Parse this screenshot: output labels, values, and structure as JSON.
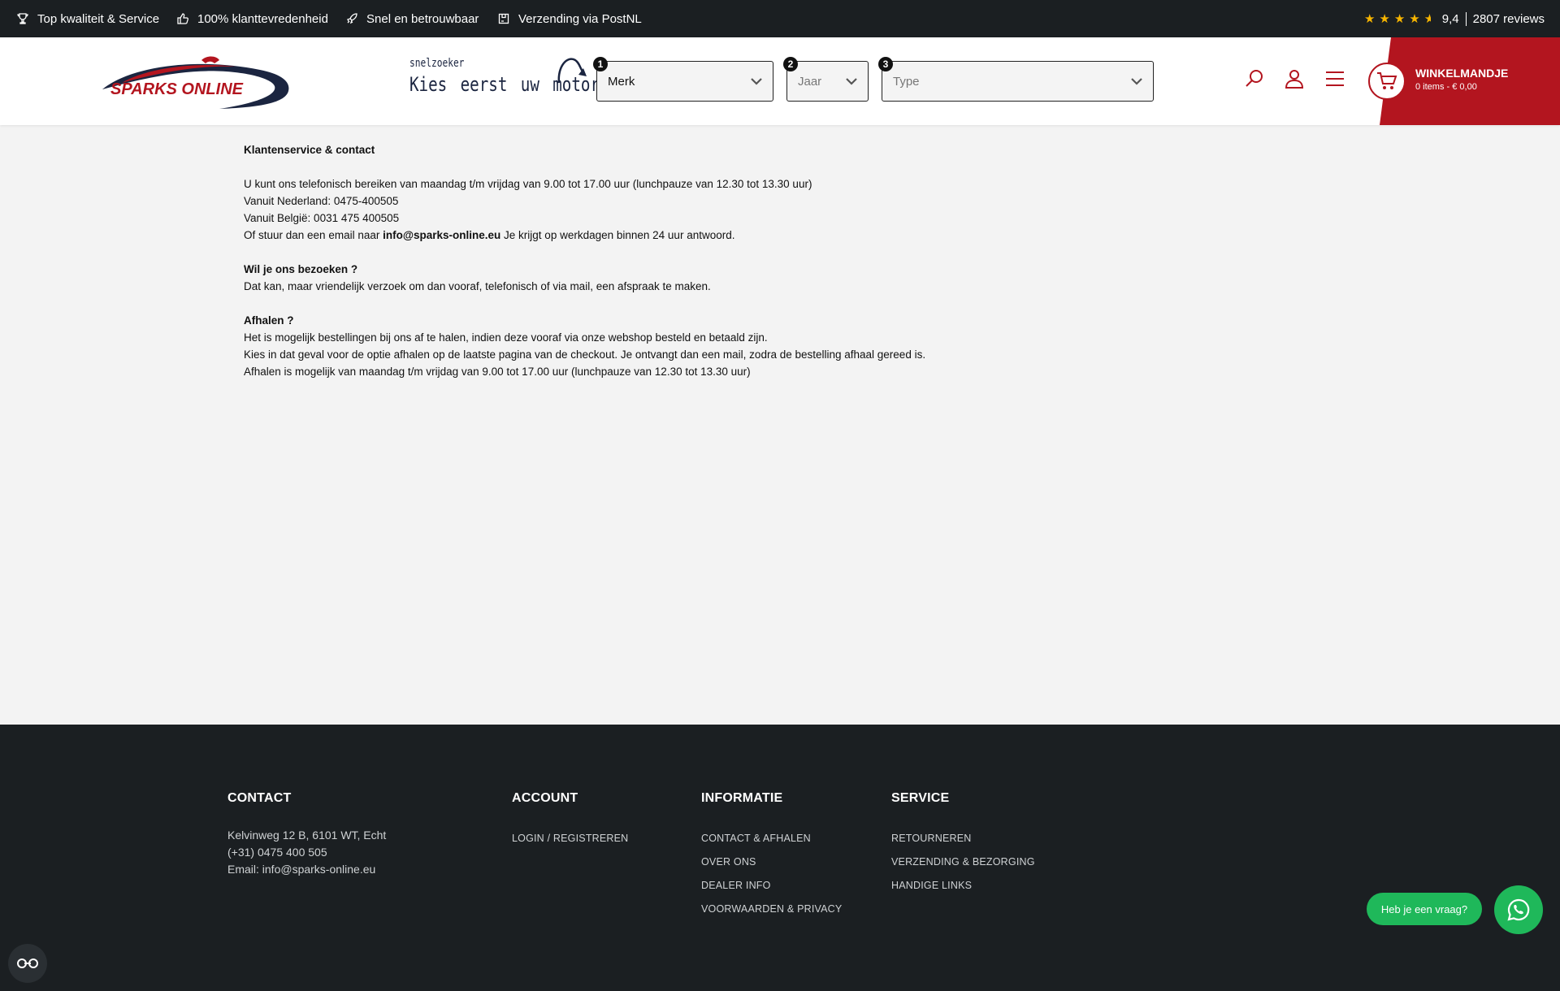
{
  "topbar": {
    "usps": [
      "Top kwaliteit & Service",
      "100% klanttevredenheid",
      "Snel en betrouwbaar",
      "Verzending via PostNL"
    ],
    "rating": {
      "stars": 4.5,
      "score": "9,4",
      "reviews": "2807 reviews"
    }
  },
  "header": {
    "logo_text": "SPARKS ONLINE",
    "quick_small": "snelzoeker",
    "quick_big": "Kies eerst uw motor",
    "selects": [
      {
        "num": "1",
        "value": "Merk"
      },
      {
        "num": "2",
        "value": "Jaar"
      },
      {
        "num": "3",
        "value": "Type"
      }
    ],
    "icons": [
      "search-icon",
      "user-icon",
      "menu-icon"
    ],
    "cart": {
      "title": "WINKELMANDJE",
      "sub": "0 items - € 0,00"
    }
  },
  "content": {
    "title": "Klantenservice & contact",
    "phone_line": "U kunt ons telefonisch bereiken van maandag t/m vrijdag van 9.00 tot 17.00 uur (lunchpauze van 12.30 tot 13.30 uur)",
    "nl": "Vanuit Nederland: 0475-400505",
    "be": "Vanuit België: 0031 475 400505",
    "email_pre": "Of stuur dan een email naar ",
    "email": "info@sparks-online.eu",
    "email_post": " Je krijgt op werkdagen binnen 24 uur antwoord.",
    "visit_title": "Wil je ons bezoeken ?",
    "visit_text": "Dat kan, maar vriendelijk verzoek om dan vooraf, telefonisch of via mail, een afspraak te maken.",
    "pickup_title": "Afhalen ?",
    "pickup_1": "Het is mogelijk bestellingen bij ons af te halen, indien deze vooraf via onze webshop besteld en betaald zijn.",
    "pickup_2": "Kies in dat geval voor de optie afhalen op de laatste pagina van de checkout. Je ontvangt dan een mail, zodra de bestelling afhaal gereed is.",
    "pickup_3": "Afhalen is mogelijk van maandag t/m vrijdag van 9.00 tot 17.00 uur (lunchpauze van 12.30 tot 13.30 uur)"
  },
  "footer": {
    "contact": {
      "title": "CONTACT",
      "lines": [
        "Kelvinweg 12 B, 6101 WT, Echt",
        "(+31) 0475 400 505",
        "Email: info@sparks-online.eu"
      ]
    },
    "account": {
      "title": "ACCOUNT",
      "links": [
        "LOGIN / REGISTREREN"
      ]
    },
    "informatie": {
      "title": "INFORMATIE",
      "links": [
        "CONTACT & AFHALEN",
        "OVER ONS",
        "DEALER INFO",
        "VOORWAARDEN & PRIVACY"
      ]
    },
    "service": {
      "title": "SERVICE",
      "links": [
        "RETOURNEREN",
        "VERZENDING & BEZORGING",
        "HANDIGE LINKS"
      ]
    }
  },
  "whatsapp": {
    "label": "Heb je een vraag?"
  },
  "colors": {
    "brand_red": "#b3151f",
    "dark": "#1b1f22",
    "whatsapp": "#1fb85a",
    "star": "#f7b500"
  }
}
